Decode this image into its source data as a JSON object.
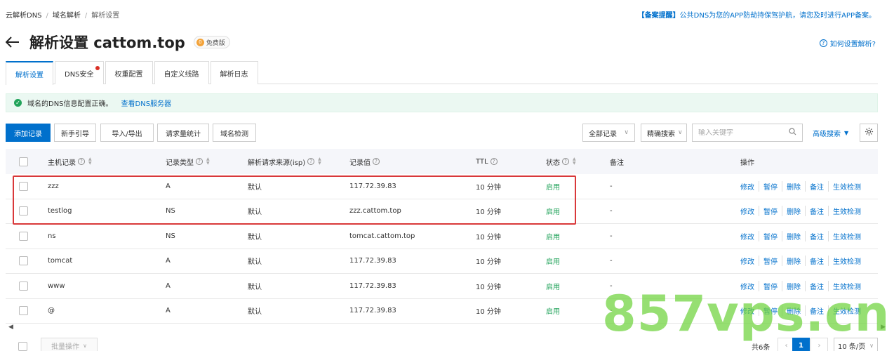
{
  "breadcrumb": [
    "云解析DNS",
    "域名解析",
    "解析设置"
  ],
  "notice": {
    "tag": "【备案提醒】",
    "text": "公共DNS为您的APP防劫持保驾护航，请您及时进行APP备案。"
  },
  "title": "解析设置 cattom.top",
  "badge": {
    "coin": "0",
    "label": "免费版"
  },
  "help": "如何设置解析?",
  "tabs": [
    "解析设置",
    "DNS安全",
    "权重配置",
    "自定义线路",
    "解析日志"
  ],
  "alert": {
    "text": "域名的DNS信息配置正确。",
    "link": "查看DNS服务器"
  },
  "toolbar": {
    "buttons": [
      "添加记录",
      "新手引导",
      "导入/导出",
      "请求量统计",
      "域名检测"
    ],
    "filter_all": "全部记录",
    "filter_mode": "精确搜索",
    "search_placeholder": "输入关键字",
    "advanced": "高级搜索"
  },
  "columns": [
    "主机记录",
    "记录类型",
    "解析请求来源(isp)",
    "记录值",
    "TTL",
    "状态",
    "备注",
    "操作"
  ],
  "ops": [
    "修改",
    "暂停",
    "删除",
    "备注",
    "生效检测"
  ],
  "rows": [
    {
      "host": "zzz",
      "type": "A",
      "isp": "默认",
      "value": "117.72.39.83",
      "ttl": "10 分钟",
      "status": "启用",
      "note": "-"
    },
    {
      "host": "testlog",
      "type": "NS",
      "isp": "默认",
      "value": "zzz.cattom.top",
      "ttl": "10 分钟",
      "status": "启用",
      "note": "-"
    },
    {
      "host": "ns",
      "type": "NS",
      "isp": "默认",
      "value": "tomcat.cattom.top",
      "ttl": "10 分钟",
      "status": "启用",
      "note": "-"
    },
    {
      "host": "tomcat",
      "type": "A",
      "isp": "默认",
      "value": "117.72.39.83",
      "ttl": "10 分钟",
      "status": "启用",
      "note": "-"
    },
    {
      "host": "www",
      "type": "A",
      "isp": "默认",
      "value": "117.72.39.83",
      "ttl": "10 分钟",
      "status": "启用",
      "note": "-"
    },
    {
      "host": "@",
      "type": "A",
      "isp": "默认",
      "value": "117.72.39.83",
      "ttl": "10 分钟",
      "status": "启用",
      "note": "-"
    }
  ],
  "footer": {
    "batch": "批量操作",
    "total": "共6条",
    "page": "1",
    "page_size": "10 条/页"
  },
  "watermark": "857vps.cn",
  "colors": {
    "accent": "#0070cc",
    "success": "#21a35a",
    "highlight": "#d9383a"
  }
}
